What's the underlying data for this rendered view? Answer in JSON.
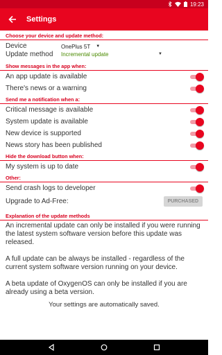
{
  "status_bar": {
    "time": "19:23"
  },
  "appbar": {
    "title": "Settings"
  },
  "sections": {
    "device": {
      "header": "Choose your device and update method:",
      "device_label": "Device",
      "update_method_label": "Update method",
      "device_value": "OnePlus 5T",
      "update_method_value": "Incremental update"
    },
    "app_messages": {
      "header": "Show messages in the app when:",
      "items": [
        {
          "label": "An app update is available"
        },
        {
          "label": "There's news or a warning"
        }
      ]
    },
    "notifications": {
      "header": "Send me a notification when a:",
      "items": [
        {
          "label": "Critical message is available"
        },
        {
          "label": "System update is available"
        },
        {
          "label": "New device is supported"
        },
        {
          "label": "News story has been published"
        }
      ]
    },
    "hide_download": {
      "header": "Hide the download button when:",
      "items": [
        {
          "label": "My system is up to date"
        }
      ]
    },
    "other": {
      "header": "Other:",
      "crash_logs_label": "Send crash logs to developer",
      "adfree_label": "Upgrade to Ad-Free:",
      "purchased_label": "PURCHASED"
    },
    "explanation": {
      "header": "Explanation of the update methods",
      "paragraphs": [
        "An incremental update can only be installed if you were running the latest system software version before this update was released.",
        "A full update can be always be installed - regardless of the current system software version running on your device.",
        "A beta update of OxygenOS can only be installed if you are already using a beta version."
      ],
      "saved_note": "Your settings are automatically saved."
    }
  },
  "colors": {
    "accent": "#e8051f",
    "statusbar": "#c8001e",
    "update_method": "#4a8a00"
  },
  "icons": [
    "bluetooth-icon",
    "wifi-icon",
    "battery-icon",
    "back-arrow-icon",
    "nav-back-icon",
    "nav-home-icon",
    "nav-recents-icon"
  ]
}
